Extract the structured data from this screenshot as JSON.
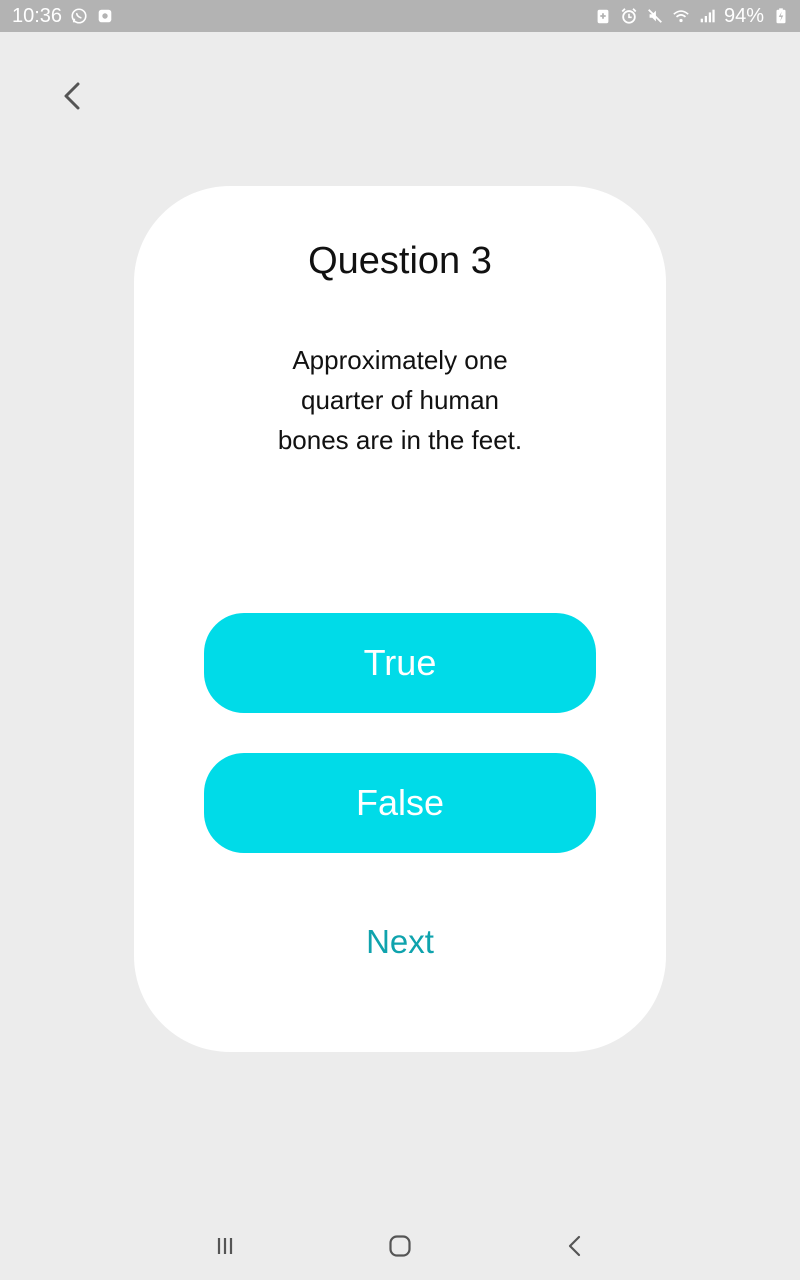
{
  "status_bar": {
    "time": "10:36",
    "battery": "94%",
    "icons_left": [
      "whatsapp-icon",
      "app-notification-icon"
    ],
    "icons_right": [
      "battery-saver-icon",
      "alarm-icon",
      "mute-icon",
      "wifi-icon",
      "signal-icon",
      "charging-battery-icon"
    ]
  },
  "header": {
    "back_icon": "chevron-left-icon"
  },
  "quiz": {
    "title": "Question 3",
    "question": "Approximately one quarter of human bones are in the feet.",
    "answers": {
      "true_label": "True",
      "false_label": "False"
    },
    "next_label": "Next"
  },
  "nav_bar": {
    "icons": [
      "recent-apps-icon",
      "home-icon",
      "back-nav-icon"
    ]
  },
  "colors": {
    "accent": "#00dbe8",
    "next_text": "#0fa3ad",
    "background": "#ececec",
    "card": "#ffffff",
    "status_bar": "#b3b3b3"
  }
}
